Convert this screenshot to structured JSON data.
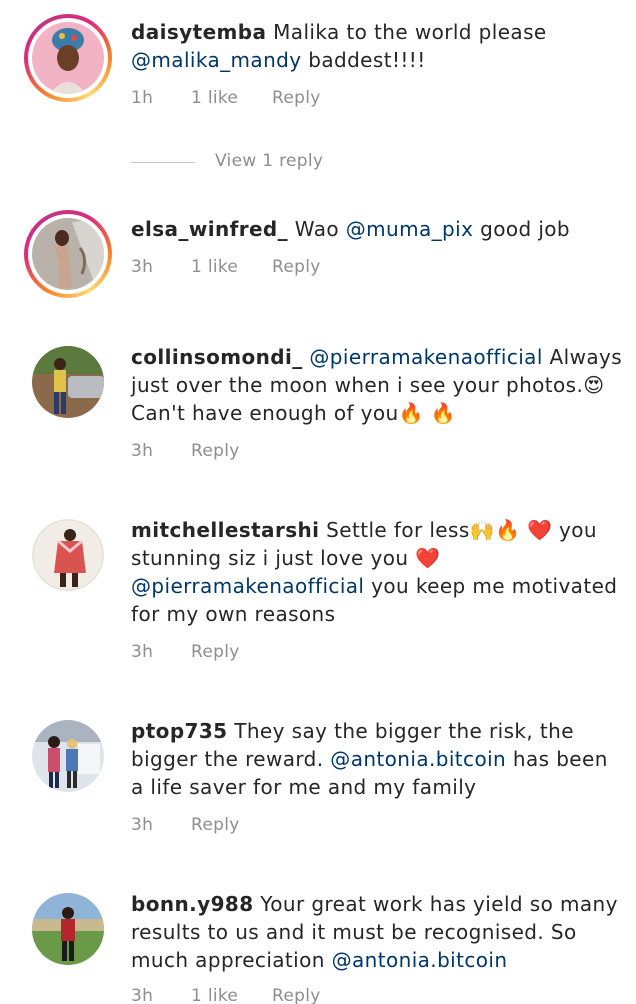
{
  "comments": [
    {
      "username": "daisytemba",
      "segments": [
        {
          "type": "text",
          "value": " Malika to the world please "
        },
        {
          "type": "mention",
          "value": "@malika_mandy"
        },
        {
          "type": "text",
          "value": " baddest!!!!"
        }
      ],
      "time": "1h",
      "likes": "1 like",
      "reply_label": "Reply",
      "view_replies": "View 1 reply"
    },
    {
      "username": "elsa_winfred_",
      "segments": [
        {
          "type": "text",
          "value": " Wao "
        },
        {
          "type": "mention",
          "value": "@muma_pix"
        },
        {
          "type": "text",
          "value": "  good job"
        }
      ],
      "time": "3h",
      "likes": "1 like",
      "reply_label": "Reply"
    },
    {
      "username": "collinsomondi_",
      "segments": [
        {
          "type": "text",
          "value": " "
        },
        {
          "type": "mention",
          "value": "@pierramakenaofficial"
        },
        {
          "type": "text",
          "value": " Always just over the moon when i see your photos.😍 Can't have enough of you🔥 🔥"
        }
      ],
      "time": "3h",
      "reply_label": "Reply"
    },
    {
      "username": "mitchellestarshi",
      "segments": [
        {
          "type": "text",
          "value": " Settle for less🙌🔥 ❤️ you stunning siz i just love you ❤️ "
        },
        {
          "type": "mention",
          "value": "@pierramakenaofficial"
        },
        {
          "type": "text",
          "value": "  you keep me motivated for my own reasons"
        }
      ],
      "time": "3h",
      "reply_label": "Reply"
    },
    {
      "username": "ptop735",
      "segments": [
        {
          "type": "text",
          "value": " They say the bigger the risk, the bigger the reward. "
        },
        {
          "type": "mention",
          "value": "@antonia.bitcoin"
        },
        {
          "type": "text",
          "value": " has been a life saver for me and my family"
        }
      ],
      "time": "3h",
      "reply_label": "Reply"
    },
    {
      "username": "bonn.y988",
      "segments": [
        {
          "type": "text",
          "value": " Your great work has yield so many results to us and it must be recognised. So much appreciation "
        },
        {
          "type": "mention",
          "value": "@antonia.bitcoin"
        }
      ],
      "time": "3h",
      "likes": "1 like",
      "reply_label": "Reply"
    }
  ],
  "colors": {
    "text": "#262626",
    "mention": "#00376b",
    "meta": "#8e8e8e",
    "story_ring_start": "#f58529",
    "story_ring_mid": "#dd2a7b"
  }
}
